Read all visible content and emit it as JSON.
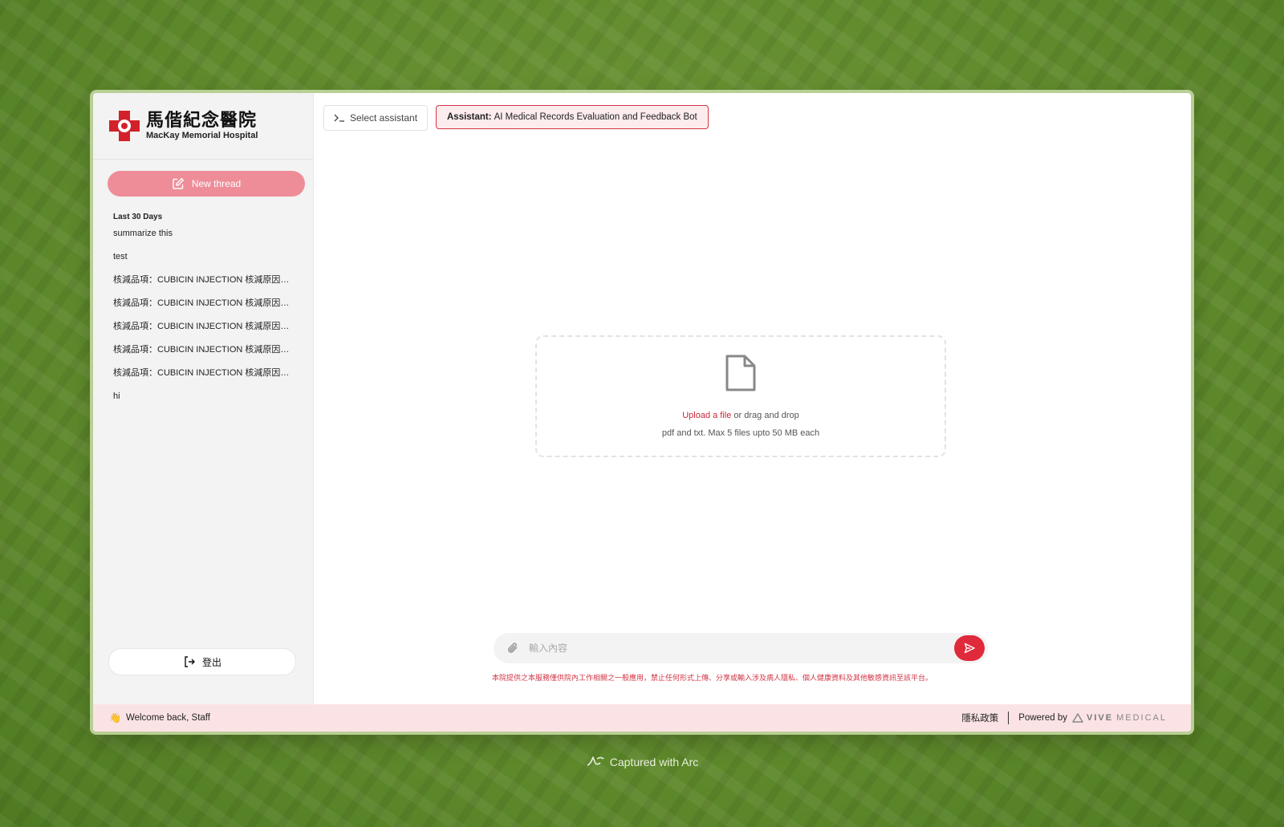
{
  "brand": {
    "logo_cn": "馬偕紀念醫院",
    "logo_en": "MacKay Memorial Hospital",
    "accent": "#d3212b"
  },
  "sidebar": {
    "new_thread_label": "New thread",
    "section_title": "Last 30 Days",
    "threads": [
      "summarize this",
      "test",
      "核減品項：CUBICIN INJECTION 核減原因：...",
      "核減品項：CUBICIN INJECTION 核減原因：...",
      "核減品項：CUBICIN INJECTION 核減原因：...",
      "核減品項：CUBICIN INJECTION 核減原因：...",
      "核減品項：CUBICIN INJECTION 核減原因：...",
      "hi"
    ],
    "logout_label": "登出"
  },
  "toolbar": {
    "select_assistant_label": "Select assistant",
    "assistant_prefix": "Assistant:",
    "assistant_name": "AI Medical Records Evaluation and Feedback Bot"
  },
  "upload": {
    "link_text": "Upload a file",
    "rest_text": " or drag and drop",
    "hint": "pdf and txt. Max 5 files upto 50 MB each"
  },
  "composer": {
    "placeholder": "輸入內容",
    "disclaimer": "本院提供之本服務僅供院內工作相關之一般應用，禁止任何形式上傳、分享或輸入涉及病人隱私、個人健康資料及其他敏感資訊至該平台。"
  },
  "footer": {
    "welcome": "Welcome back, Staff",
    "privacy": "隱私政策",
    "powered_by": "Powered by",
    "vive_bold": "VIVE",
    "vive_light": "MEDICAL"
  },
  "capture": {
    "label": "Captured with Arc"
  },
  "colors": {
    "background": "#628a2f",
    "new_thread_bg": "#ee8d98",
    "send_button": "#df2a3c",
    "footer_bg": "#fbe3e5"
  }
}
